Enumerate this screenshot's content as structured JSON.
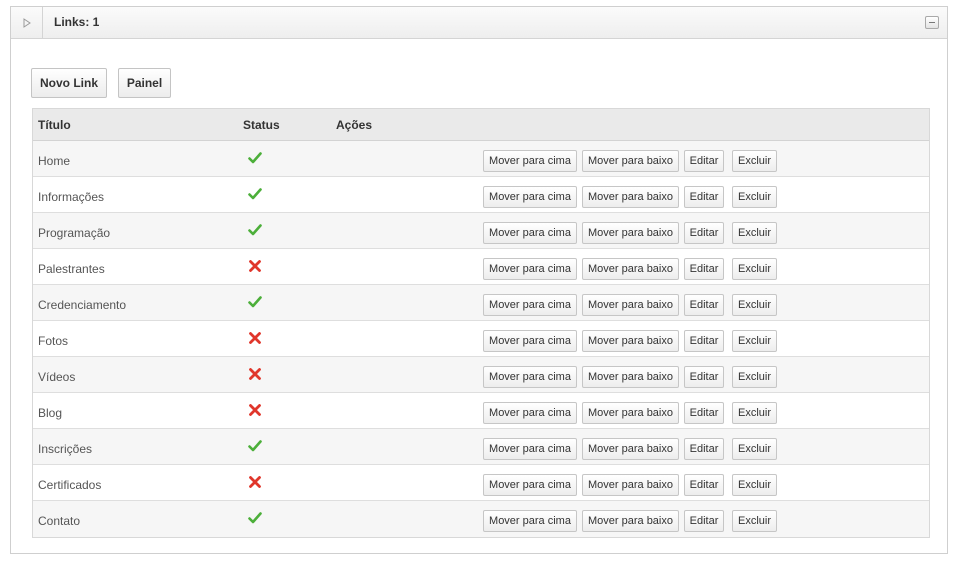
{
  "panel": {
    "title": "Links: 1"
  },
  "toolbar": {
    "new_link_label": "Novo Link",
    "panel_label": "Painel"
  },
  "table": {
    "headers": {
      "title": "Título",
      "status": "Status",
      "actions": "Ações"
    },
    "actions": {
      "move_up": "Mover para cima",
      "move_down": "Mover para baixo",
      "edit": "Editar",
      "delete": "Excluir"
    },
    "rows": [
      {
        "title": "Home",
        "status": "active"
      },
      {
        "title": "Informações",
        "status": "active"
      },
      {
        "title": "Programação",
        "status": "active"
      },
      {
        "title": "Palestrantes",
        "status": "inactive"
      },
      {
        "title": "Credenciamento",
        "status": "active"
      },
      {
        "title": "Fotos",
        "status": "inactive"
      },
      {
        "title": "Vídeos",
        "status": "inactive"
      },
      {
        "title": "Blog",
        "status": "inactive"
      },
      {
        "title": "Inscrições",
        "status": "active"
      },
      {
        "title": "Certificados",
        "status": "inactive"
      },
      {
        "title": "Contato",
        "status": "active"
      }
    ]
  },
  "colors": {
    "check": "#4caf3a",
    "cross": "#e0362b"
  }
}
